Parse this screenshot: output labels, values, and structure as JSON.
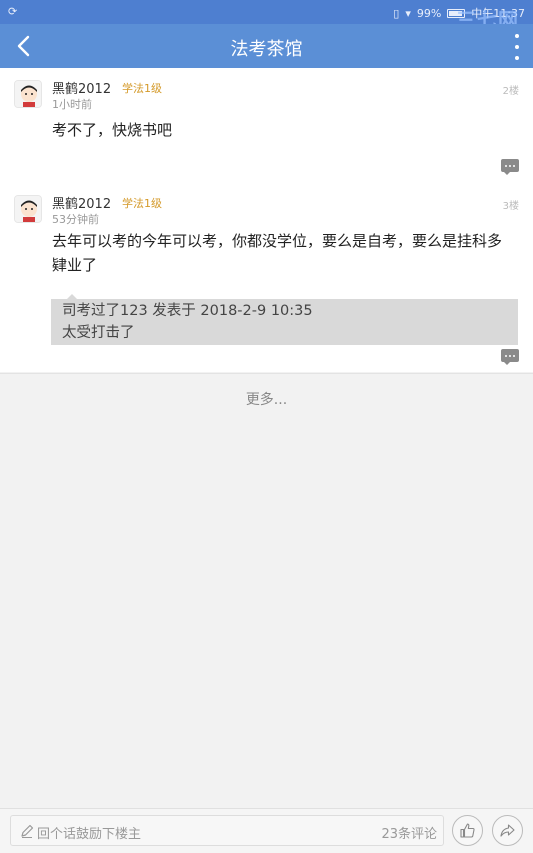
{
  "status_bar": {
    "left_icon": "sync-icon",
    "battery": "99%",
    "time": "中午11:37"
  },
  "watermark": "三七网",
  "app_bar": {
    "title": "法考茶馆",
    "back_icon": "back-arrow-icon",
    "more_icon": "more-vert-icon"
  },
  "posts": [
    {
      "username": "黑鹤2012",
      "level": "学法1级",
      "time": "1小时前",
      "floor": "2楼",
      "content": "考不了，快烧书吧",
      "reply_icon": "comment-icon"
    },
    {
      "username": "黑鹤2012",
      "level": "学法1级",
      "time": "53分钟前",
      "floor": "3楼",
      "content": "去年可以考的今年可以考，你都没学位，要么是自考，要么是挂科多肄业了",
      "quote": {
        "header": "司考过了123 发表于 2018-2-9 10:35",
        "text": "太受打击了"
      },
      "reply_icon": "comment-icon"
    }
  ],
  "load_more": "更多...",
  "bottom_bar": {
    "placeholder": "回个话鼓励下楼主",
    "comment_count": "23条评论",
    "like_icon": "thumbs-up-icon",
    "share_icon": "share-icon"
  }
}
